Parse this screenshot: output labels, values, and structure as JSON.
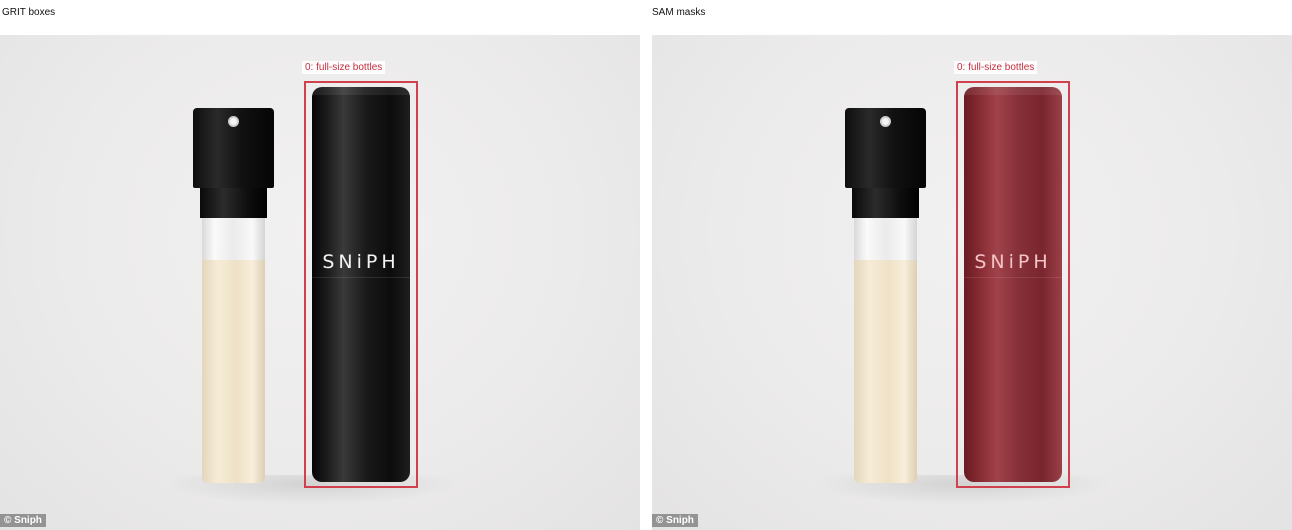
{
  "panels": [
    {
      "title": "GRIT boxes",
      "detections": [
        {
          "label": "0: full-size bottles",
          "color": "#d1404d"
        }
      ],
      "bottle_brand": "SNiPH",
      "credit": "© Sniph"
    },
    {
      "title": "SAM masks",
      "detections": [
        {
          "label": "0: full-size bottles",
          "color": "#d1404d"
        }
      ],
      "bottle_brand": "SNiPH",
      "credit": "© Sniph"
    }
  ]
}
